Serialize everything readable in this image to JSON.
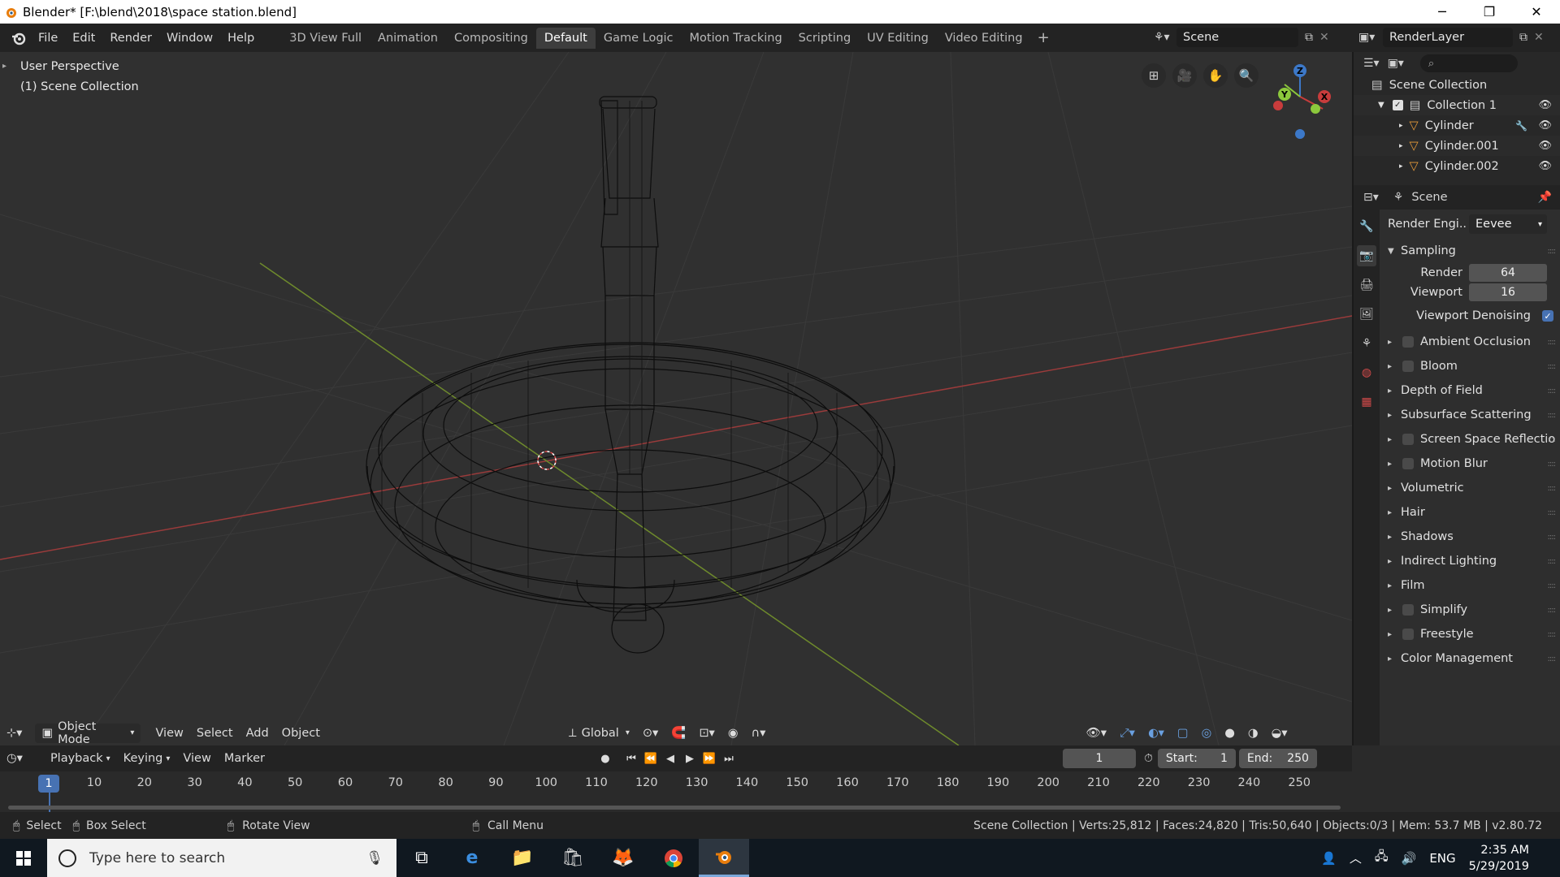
{
  "window": {
    "title": "Blender* [F:\\blend\\2018\\space station.blend]",
    "minimize": "─",
    "restore": "❐",
    "close": "✕"
  },
  "topbar": {
    "menus": [
      "File",
      "Edit",
      "Render",
      "Window",
      "Help"
    ],
    "workspaces": [
      "3D View Full",
      "Animation",
      "Compositing",
      "Default",
      "Game Logic",
      "Motion Tracking",
      "Scripting",
      "UV Editing",
      "Video Editing"
    ],
    "active_workspace": "Default",
    "add_tab": "+",
    "scene_name": "Scene",
    "render_layer": "RenderLayer"
  },
  "viewport": {
    "perspective": "User Perspective",
    "collection": "(1) Scene Collection",
    "header": {
      "mode": "Object Mode",
      "menus": [
        "View",
        "Select",
        "Add",
        "Object"
      ],
      "transform_orientation": "Global"
    },
    "gizmo": {
      "x": "X",
      "y": "Y",
      "z": "Z"
    }
  },
  "outliner": {
    "root": "Scene Collection",
    "collection": "Collection 1",
    "objects": [
      "Cylinder",
      "Cylinder.001",
      "Cylinder.002"
    ]
  },
  "properties": {
    "context": "Scene",
    "render_engine_label": "Render Engi..",
    "render_engine": "Eevee",
    "sampling": {
      "label": "Sampling",
      "render_label": "Render",
      "render_value": "64",
      "viewport_label": "Viewport",
      "viewport_value": "16",
      "denoise_label": "Viewport Denoising"
    },
    "panels": [
      {
        "label": "Ambient Occlusion",
        "checkbox": true
      },
      {
        "label": "Bloom",
        "checkbox": true
      },
      {
        "label": "Depth of Field",
        "checkbox": false
      },
      {
        "label": "Subsurface Scattering",
        "checkbox": false
      },
      {
        "label": "Screen Space Reflectio",
        "checkbox": true
      },
      {
        "label": "Motion Blur",
        "checkbox": true
      },
      {
        "label": "Volumetric",
        "checkbox": false
      },
      {
        "label": "Hair",
        "checkbox": false
      },
      {
        "label": "Shadows",
        "checkbox": false
      },
      {
        "label": "Indirect Lighting",
        "checkbox": false
      },
      {
        "label": "Film",
        "checkbox": false
      },
      {
        "label": "Simplify",
        "checkbox": true
      },
      {
        "label": "Freestyle",
        "checkbox": true
      },
      {
        "label": "Color Management",
        "checkbox": false
      }
    ]
  },
  "timeline": {
    "menus": [
      "Playback",
      "Keying",
      "View",
      "Marker"
    ],
    "current_frame": "1",
    "start_label": "Start:",
    "start": "1",
    "end_label": "End:",
    "end": "250",
    "ticks": [
      "10",
      "20",
      "30",
      "40",
      "50",
      "60",
      "70",
      "80",
      "90",
      "100",
      "110",
      "120",
      "130",
      "140",
      "150",
      "160",
      "170",
      "180",
      "190",
      "200",
      "210",
      "220",
      "230",
      "240",
      "250"
    ],
    "cursor_frame": "1"
  },
  "statusbar": {
    "select": "Select",
    "box_select": "Box Select",
    "rotate_view": "Rotate View",
    "call_menu": "Call Menu",
    "stats": "Scene Collection | Verts:25,812 | Faces:24,820 | Tris:50,640 | Objects:0/3 | Mem: 53.7 MB | v2.80.72"
  },
  "taskbar": {
    "search_placeholder": "Type here to search",
    "language": "ENG",
    "time": "2:35 AM",
    "date": "5/29/2019"
  },
  "colors": {
    "accent": "#4772b3",
    "x_axis": "#c83c3c",
    "y_axis": "#8cc83c",
    "z_axis": "#3c78c8"
  }
}
